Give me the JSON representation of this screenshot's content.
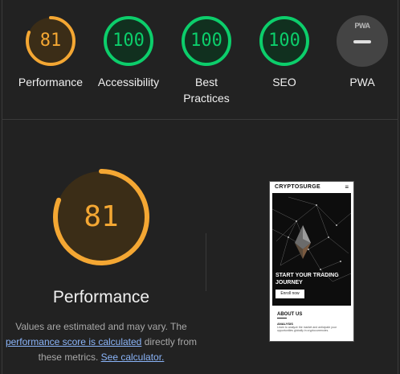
{
  "summary": {
    "categories": [
      {
        "score": "81",
        "label": "Performance",
        "color": "#f4a733",
        "fraction": 0.81
      },
      {
        "score": "100",
        "label": "Accessibility",
        "color": "#0cce6b",
        "fraction": 1.0
      },
      {
        "score": "100",
        "label": "Best Practices",
        "color": "#0cce6b",
        "fraction": 1.0
      },
      {
        "score": "100",
        "label": "SEO",
        "color": "#0cce6b",
        "fraction": 1.0
      },
      {
        "score": "",
        "label": "PWA",
        "icon": "pwa-badge-icon",
        "badge_text": "PWA"
      }
    ]
  },
  "detail": {
    "score": "81",
    "fraction": 0.81,
    "color": "#f4a733",
    "title": "Performance",
    "desc_1": "Values are estimated and may vary. The",
    "link_1": "performance score is calculated",
    "desc_2": " directly from these metrics. ",
    "link_2": "See calculator."
  },
  "screenshot": {
    "brand": "CRYPTOSURGE",
    "menu_icon": "hamburger-icon",
    "hero_title": "START YOUR TRADING JOURNEY",
    "hero_button": "Enroll now",
    "about_heading": "ABOUT US",
    "about_sub": "ANALYSIS",
    "about_text": "Learn to analyze the market and anticipate your opportunities globally in cryptocurrencies."
  },
  "colors": {
    "background": "#222222",
    "average": "#f4a733",
    "pass": "#0cce6b",
    "link": "#8ab4f8"
  }
}
